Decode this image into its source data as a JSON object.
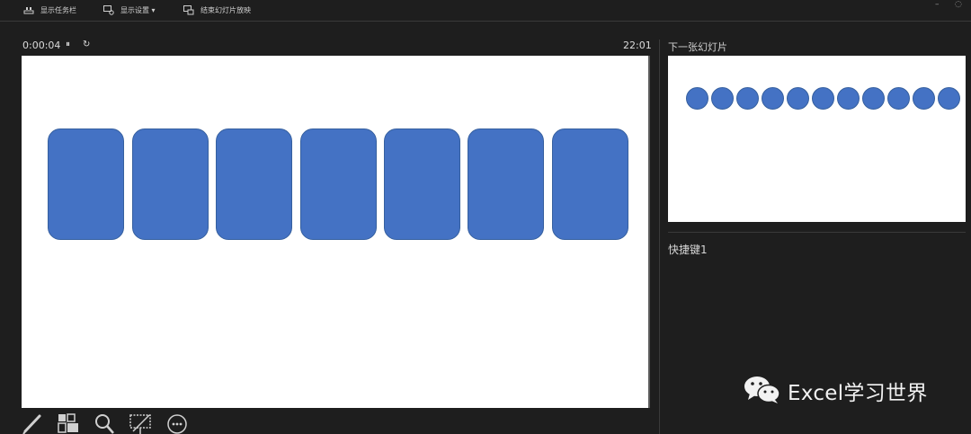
{
  "toolbar": {
    "show_taskbar_label": "显示任务栏",
    "display_settings_label": "显示设置 ▾",
    "end_slideshow_label": "结束幻灯片放映"
  },
  "timer": {
    "elapsed": "0:00:04",
    "pause_glyph": "⏸",
    "restart_glyph": "↻",
    "clock": "22:01"
  },
  "current_slide": {
    "shape_color": "#4472c4",
    "shape_count": 7
  },
  "next_slide": {
    "label": "下一张幻灯片",
    "shape_color": "#4472c4",
    "shape_count": 11
  },
  "notes": {
    "text": "快捷键1"
  },
  "tools": [
    {
      "name": "pen-icon"
    },
    {
      "name": "view-all-slides-icon"
    },
    {
      "name": "zoom-icon"
    },
    {
      "name": "screen-black-icon"
    },
    {
      "name": "more-options-icon"
    }
  ],
  "watermark": {
    "text": "Excel学习世界"
  }
}
